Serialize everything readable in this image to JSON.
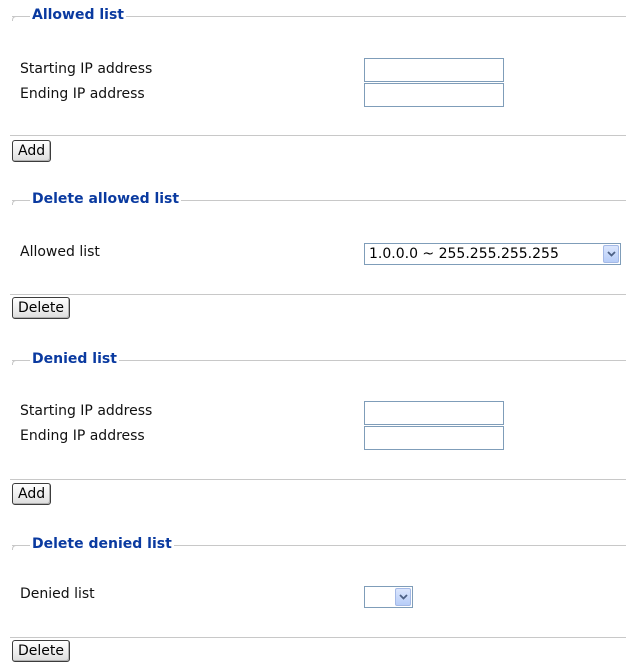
{
  "sections": {
    "allowed": {
      "title": "Allowed list",
      "start_label": "Starting IP address",
      "end_label": "Ending IP address",
      "start_value": "",
      "end_value": "",
      "add_label": "Add"
    },
    "delete_allowed": {
      "title": "Delete allowed list",
      "list_label": "Allowed list",
      "selected": "1.0.0.0 ~ 255.255.255.255",
      "delete_label": "Delete"
    },
    "denied": {
      "title": "Denied list",
      "start_label": "Starting IP address",
      "end_label": "Ending IP address",
      "start_value": "",
      "end_value": "",
      "add_label": "Add"
    },
    "delete_denied": {
      "title": "Delete denied list",
      "list_label": "Denied list",
      "selected": "",
      "delete_label": "Delete"
    }
  },
  "icons": {
    "dropdown": "chevron-down-icon"
  },
  "colors": {
    "legend_title": "#0a3aa0",
    "divider": "#c8c8c8",
    "input_border": "#7f9db9"
  }
}
